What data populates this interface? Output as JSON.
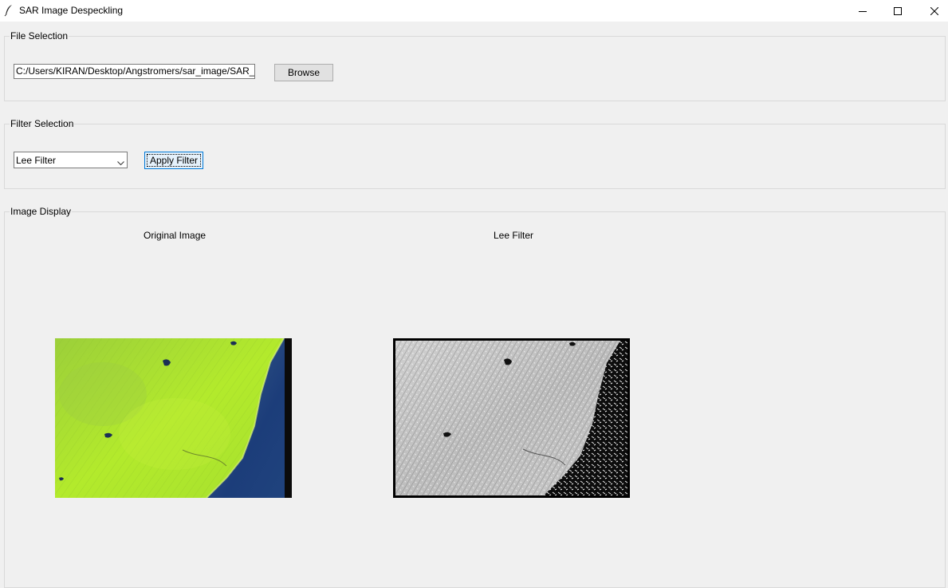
{
  "window": {
    "title": "SAR Image Despeckling",
    "icon": "feather-icon"
  },
  "file_section": {
    "legend": "File Selection",
    "path_value": "C:/Users/KIRAN/Desktop/Angstromers/sar_image/SAR_d",
    "browse_label": "Browse"
  },
  "filter_section": {
    "legend": "Filter Selection",
    "selected_filter": "Lee Filter",
    "apply_label": "Apply Filter"
  },
  "display_section": {
    "legend": "Image Display",
    "original_caption": "Original Image",
    "filtered_caption": "Lee Filter"
  },
  "colors": {
    "land_green": "#a6e02e",
    "water_blue": "#1c3d7a",
    "focus_blue": "#0078d7"
  }
}
